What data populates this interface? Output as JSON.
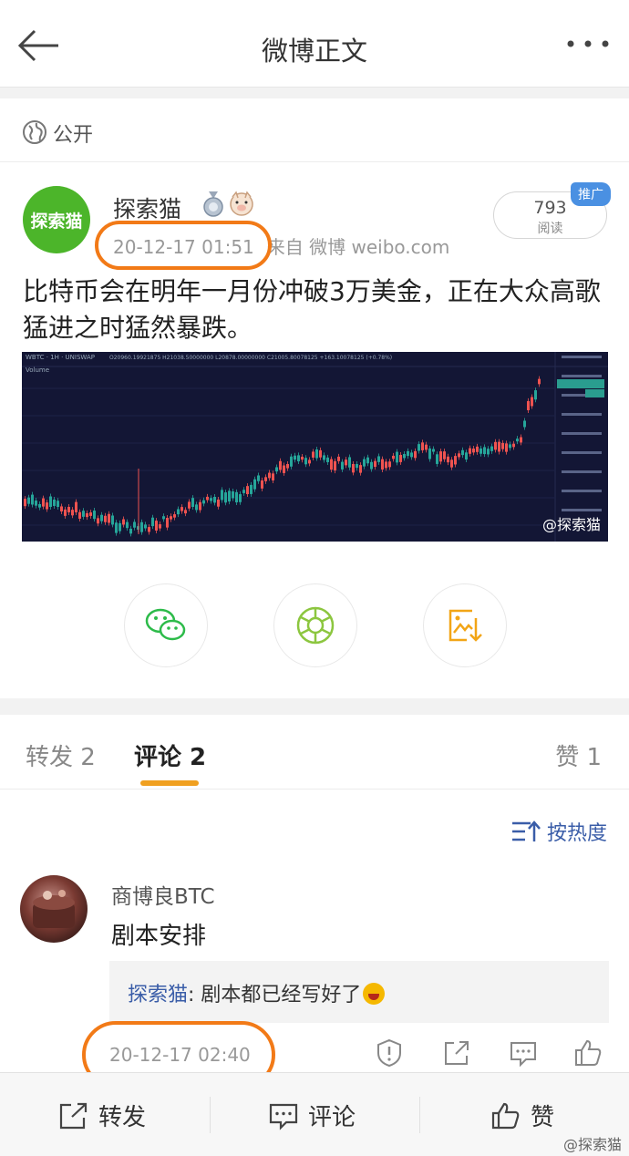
{
  "nav": {
    "title": "微博正文"
  },
  "visibility": "公开",
  "post": {
    "avatar_text": "探索猫",
    "author": "探索猫",
    "time": "20-12-17 01:51",
    "source": "来自 微博 weibo.com",
    "reads_count": "793",
    "reads_label": "阅读",
    "promo_label": "推广",
    "content": "比特币会在明年一月份冲破3万美金，正在大众高歌猛进之时猛然暴跌。",
    "image_watermark": "@探索猫"
  },
  "tabs": [
    {
      "label": "转发 2"
    },
    {
      "label": "评论 2"
    },
    {
      "label": "赞 1"
    }
  ],
  "sort_label": "按热度",
  "comment": {
    "user": "商博良BTC",
    "text": "剧本安排",
    "reply_author": "探索猫",
    "reply_text": ": 剧本都已经写好了",
    "time": "20-12-17 02:40"
  },
  "bottom_bar": {
    "repost": "转发",
    "comment": "评论",
    "like": "赞"
  },
  "watermark": "@探索猫",
  "colors": {
    "accent": "#f0a020",
    "link": "#3a5da8",
    "avatar_green": "#4cb52a",
    "highlight": "#f27a17"
  }
}
